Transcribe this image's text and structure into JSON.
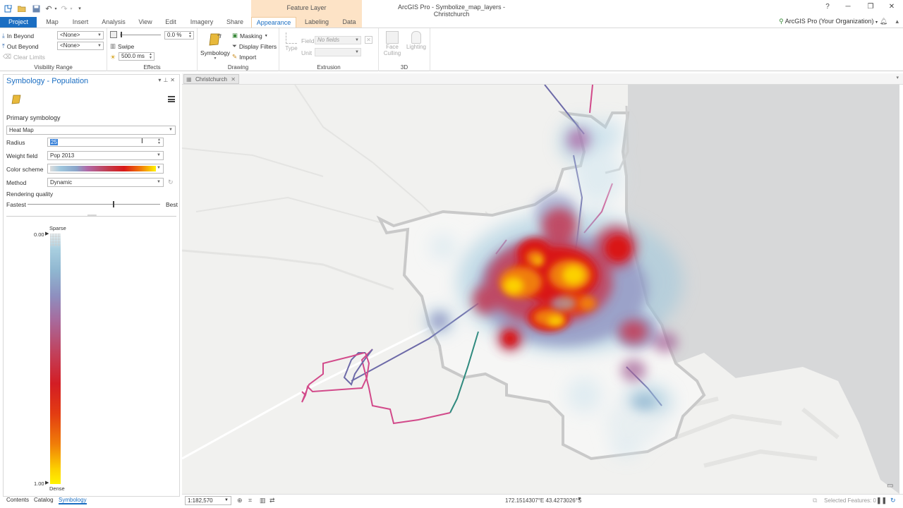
{
  "title_bar": {
    "app_title": "ArcGIS Pro - Symbolize_map_layers - Christchurch",
    "context_group": "Feature Layer",
    "help": "?"
  },
  "tabs": [
    "Project",
    "Map",
    "Insert",
    "Analysis",
    "View",
    "Edit",
    "Imagery",
    "Share",
    "Appearance",
    "Labeling",
    "Data"
  ],
  "account": "ArcGIS Pro (Your Organization)",
  "ribbon": {
    "visibility": {
      "in_beyond": "In Beyond",
      "out_beyond": "Out Beyond",
      "clear_limits": "Clear Limits",
      "in_value": "<None>",
      "out_value": "<None>",
      "label": "Visibility Range"
    },
    "effects": {
      "transparency": "0.0 %",
      "swipe": "Swipe",
      "flicker": "500.0  ms",
      "label": "Effects"
    },
    "drawing": {
      "symbology": "Symbology",
      "masking": "Masking",
      "display_filters": "Display Filters",
      "import": "Import",
      "label": "Drawing"
    },
    "extrusion": {
      "type": "Type",
      "field": "Field",
      "field_value": "No fields",
      "unit": "Unit",
      "label": "Extrusion"
    },
    "three_d": {
      "face_culling": "Face Culling",
      "lighting": "Lighting",
      "label": "3D"
    }
  },
  "pane": {
    "title": "Symbology - Population",
    "primary_symbology": "Primary symbology",
    "renderer": "Heat Map",
    "radius_label": "Radius",
    "radius_value": "25",
    "weight_label": "Weight field",
    "weight_value": "Pop 2013",
    "color_label": "Color scheme",
    "method_label": "Method",
    "method_value": "Dynamic",
    "quality_label": "Rendering quality",
    "fastest": "Fastest",
    "best": "Best",
    "rendering_quality": 0.65,
    "legend": {
      "sparse": "Sparse",
      "dense": "Dense",
      "min": "0.00",
      "max": "1.00"
    },
    "bottom_tabs": [
      "Contents",
      "Catalog",
      "Symbology"
    ]
  },
  "map": {
    "tab": "Christchurch",
    "scale": "1:182,570",
    "coordinates": "172.1514307°E 43.4273026°S",
    "selected_features": "Selected Features: 0"
  },
  "colors": {
    "accent": "#1b6ec2",
    "context_tab": "#fde3c6",
    "land": "#f1f1ef",
    "water": "#d7d8d9",
    "pink_line": "#d24a8a",
    "purple_line": "#6d6aa8",
    "teal_line": "#2f8a7e"
  }
}
